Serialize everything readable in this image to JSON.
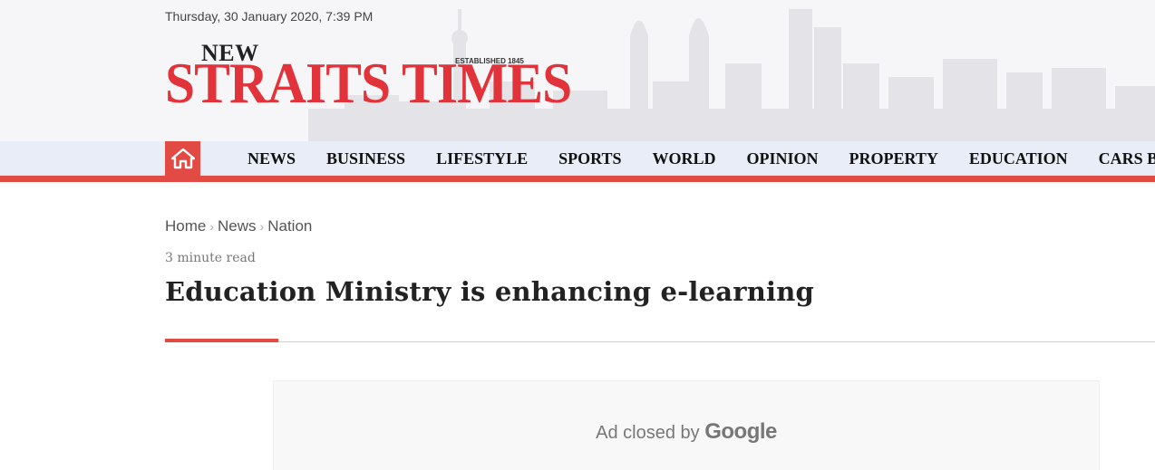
{
  "header": {
    "date": "Thursday, 30 January 2020, 7:39 PM",
    "logo": {
      "top": "NEW",
      "main": "STRAITS TIMES",
      "established": "ESTABLISHED 1845"
    }
  },
  "nav": {
    "home_icon": "home-icon",
    "items": [
      "NEWS",
      "BUSINESS",
      "LIFESTYLE",
      "SPORTS",
      "WORLD",
      "OPINION",
      "PROPERTY",
      "EDUCATION",
      "CARS B"
    ]
  },
  "breadcrumb": {
    "items": [
      "Home",
      "News",
      "Nation"
    ],
    "separator": "›"
  },
  "article": {
    "read_time": "3 minute read",
    "title": "Education Ministry is enhancing e-learning"
  },
  "ad": {
    "text": "Ad closed by",
    "brand": "Google"
  },
  "colors": {
    "accent": "#e24b43",
    "navbar": "#e8edf7"
  }
}
